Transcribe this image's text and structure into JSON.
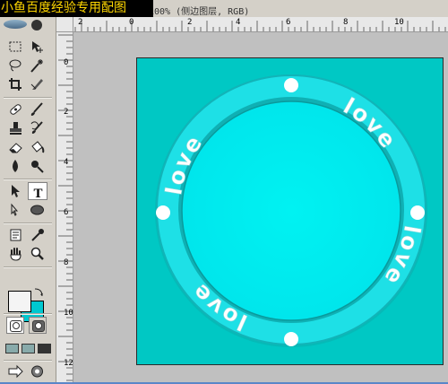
{
  "watermark": "小鱼百度经验专用配图",
  "document": {
    "title": "100% (侧边图层, RGB)"
  },
  "rulers": {
    "top": [
      "2",
      "0",
      "2",
      "4",
      "6",
      "8",
      "10"
    ],
    "left": [
      "0",
      "2",
      "4",
      "6",
      "8",
      "10",
      "12"
    ]
  },
  "colors": {
    "foreground": "#f4f4f4",
    "background": "#00c8d0",
    "canvas": "#00c8c4",
    "ring": "#1ee0e6",
    "inner_disc": "#00f0f0"
  },
  "tools": {
    "active": "type-tool-icon",
    "list": [
      "marquee-tool-icon",
      "move-tool-icon",
      "lasso-tool-icon",
      "magic-wand-tool-icon",
      "crop-tool-icon",
      "slice-tool-icon",
      "healing-brush-tool-icon",
      "brush-tool-icon",
      "clone-stamp-tool-icon",
      "history-brush-tool-icon",
      "eraser-tool-icon",
      "paint-bucket-tool-icon",
      "blur-tool-icon",
      "dodge-tool-icon",
      "path-selection-tool-icon",
      "type-tool-icon",
      "pen-tool-icon",
      "ellipse-tool-icon",
      "notes-tool-icon",
      "eyedropper-tool-icon",
      "hand-tool-icon",
      "zoom-tool-icon"
    ]
  },
  "artwork": {
    "words": [
      "love",
      "love",
      "love",
      "love"
    ]
  }
}
